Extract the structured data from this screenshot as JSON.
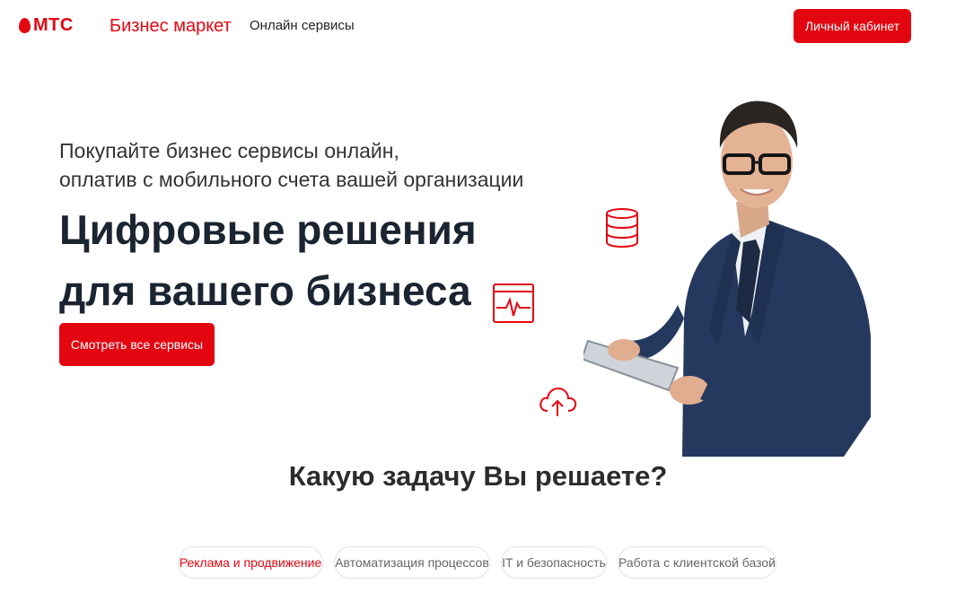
{
  "header": {
    "logo_text": "МТС",
    "brand": "Бизнес маркет",
    "nav_link": "Онлайн сервисы",
    "cabinet_button": "Личный кабинет"
  },
  "hero": {
    "subtitle_line1": "Покупайте бизнес сервисы онлайн,",
    "subtitle_line2": "оплатив с мобильного счета вашей организации",
    "title_line1": "Цифровые решения",
    "title_line2": "для вашего бизнеса",
    "cta_button": "Смотреть все сервисы",
    "decor_icons": [
      "database-icon",
      "monitor-pulse-icon",
      "cloud-upload-icon"
    ]
  },
  "tasks": {
    "question": "Какую задачу Вы решаете?",
    "tags": [
      {
        "label": "Реклама и продвижение",
        "active": true
      },
      {
        "label": "Автоматизация процессов",
        "active": false
      },
      {
        "label": "IT и безопасность",
        "active": false
      },
      {
        "label": "Работа с клиентской базой",
        "active": false
      }
    ]
  },
  "colors": {
    "brand_red": "#e30611",
    "title_dark": "#1b2431",
    "suit_blue": "#25395f"
  }
}
